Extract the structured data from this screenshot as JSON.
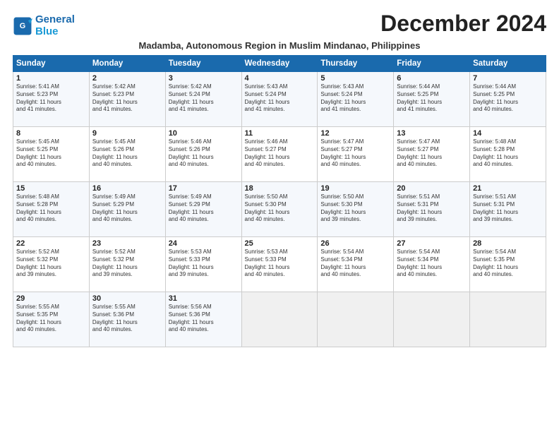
{
  "logo": {
    "line1": "General",
    "line2": "Blue"
  },
  "header": {
    "month_year": "December 2024",
    "location": "Madamba, Autonomous Region in Muslim Mindanao, Philippines"
  },
  "days_of_week": [
    "Sunday",
    "Monday",
    "Tuesday",
    "Wednesday",
    "Thursday",
    "Friday",
    "Saturday"
  ],
  "weeks": [
    [
      {
        "day": 1,
        "sunrise": "5:41 AM",
        "sunset": "5:23 PM",
        "daylight": "11 hours and 41 minutes."
      },
      {
        "day": 2,
        "sunrise": "5:42 AM",
        "sunset": "5:23 PM",
        "daylight": "11 hours and 41 minutes."
      },
      {
        "day": 3,
        "sunrise": "5:42 AM",
        "sunset": "5:24 PM",
        "daylight": "11 hours and 41 minutes."
      },
      {
        "day": 4,
        "sunrise": "5:43 AM",
        "sunset": "5:24 PM",
        "daylight": "11 hours and 41 minutes."
      },
      {
        "day": 5,
        "sunrise": "5:43 AM",
        "sunset": "5:24 PM",
        "daylight": "11 hours and 41 minutes."
      },
      {
        "day": 6,
        "sunrise": "5:44 AM",
        "sunset": "5:25 PM",
        "daylight": "11 hours and 41 minutes."
      },
      {
        "day": 7,
        "sunrise": "5:44 AM",
        "sunset": "5:25 PM",
        "daylight": "11 hours and 40 minutes."
      }
    ],
    [
      {
        "day": 8,
        "sunrise": "5:45 AM",
        "sunset": "5:25 PM",
        "daylight": "11 hours and 40 minutes."
      },
      {
        "day": 9,
        "sunrise": "5:45 AM",
        "sunset": "5:26 PM",
        "daylight": "11 hours and 40 minutes."
      },
      {
        "day": 10,
        "sunrise": "5:46 AM",
        "sunset": "5:26 PM",
        "daylight": "11 hours and 40 minutes."
      },
      {
        "day": 11,
        "sunrise": "5:46 AM",
        "sunset": "5:27 PM",
        "daylight": "11 hours and 40 minutes."
      },
      {
        "day": 12,
        "sunrise": "5:47 AM",
        "sunset": "5:27 PM",
        "daylight": "11 hours and 40 minutes."
      },
      {
        "day": 13,
        "sunrise": "5:47 AM",
        "sunset": "5:27 PM",
        "daylight": "11 hours and 40 minutes."
      },
      {
        "day": 14,
        "sunrise": "5:48 AM",
        "sunset": "5:28 PM",
        "daylight": "11 hours and 40 minutes."
      }
    ],
    [
      {
        "day": 15,
        "sunrise": "5:48 AM",
        "sunset": "5:28 PM",
        "daylight": "11 hours and 40 minutes."
      },
      {
        "day": 16,
        "sunrise": "5:49 AM",
        "sunset": "5:29 PM",
        "daylight": "11 hours and 40 minutes."
      },
      {
        "day": 17,
        "sunrise": "5:49 AM",
        "sunset": "5:29 PM",
        "daylight": "11 hours and 40 minutes."
      },
      {
        "day": 18,
        "sunrise": "5:50 AM",
        "sunset": "5:30 PM",
        "daylight": "11 hours and 40 minutes."
      },
      {
        "day": 19,
        "sunrise": "5:50 AM",
        "sunset": "5:30 PM",
        "daylight": "11 hours and 39 minutes."
      },
      {
        "day": 20,
        "sunrise": "5:51 AM",
        "sunset": "5:31 PM",
        "daylight": "11 hours and 39 minutes."
      },
      {
        "day": 21,
        "sunrise": "5:51 AM",
        "sunset": "5:31 PM",
        "daylight": "11 hours and 39 minutes."
      }
    ],
    [
      {
        "day": 22,
        "sunrise": "5:52 AM",
        "sunset": "5:32 PM",
        "daylight": "11 hours and 39 minutes."
      },
      {
        "day": 23,
        "sunrise": "5:52 AM",
        "sunset": "5:32 PM",
        "daylight": "11 hours and 39 minutes."
      },
      {
        "day": 24,
        "sunrise": "5:53 AM",
        "sunset": "5:33 PM",
        "daylight": "11 hours and 39 minutes."
      },
      {
        "day": 25,
        "sunrise": "5:53 AM",
        "sunset": "5:33 PM",
        "daylight": "11 hours and 40 minutes."
      },
      {
        "day": 26,
        "sunrise": "5:54 AM",
        "sunset": "5:34 PM",
        "daylight": "11 hours and 40 minutes."
      },
      {
        "day": 27,
        "sunrise": "5:54 AM",
        "sunset": "5:34 PM",
        "daylight": "11 hours and 40 minutes."
      },
      {
        "day": 28,
        "sunrise": "5:54 AM",
        "sunset": "5:35 PM",
        "daylight": "11 hours and 40 minutes."
      }
    ],
    [
      {
        "day": 29,
        "sunrise": "5:55 AM",
        "sunset": "5:35 PM",
        "daylight": "11 hours and 40 minutes."
      },
      {
        "day": 30,
        "sunrise": "5:55 AM",
        "sunset": "5:36 PM",
        "daylight": "11 hours and 40 minutes."
      },
      {
        "day": 31,
        "sunrise": "5:56 AM",
        "sunset": "5:36 PM",
        "daylight": "11 hours and 40 minutes."
      },
      null,
      null,
      null,
      null
    ]
  ],
  "labels": {
    "sunrise": "Sunrise:",
    "sunset": "Sunset:",
    "daylight": "Daylight:"
  }
}
